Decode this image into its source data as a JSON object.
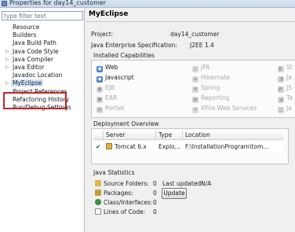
{
  "window": {
    "title": "Properties for day14_customer"
  },
  "sidebar": {
    "filter_placeholder": "type filter text",
    "items": [
      {
        "label": "Resource",
        "expandable": false
      },
      {
        "label": "Builders",
        "expandable": false
      },
      {
        "label": "Java Build Path",
        "expandable": false
      },
      {
        "label": "Java Code Style",
        "expandable": true
      },
      {
        "label": "Java Compiler",
        "expandable": true
      },
      {
        "label": "Java Editor",
        "expandable": true
      },
      {
        "label": "Javadoc Location",
        "expandable": false
      },
      {
        "label": "MyEclipse",
        "expandable": true,
        "selected": true
      },
      {
        "label": "Project References",
        "expandable": false
      },
      {
        "label": "Refactoring History",
        "expandable": false
      },
      {
        "label": "Run/Debug Settings",
        "expandable": false
      }
    ]
  },
  "main": {
    "title": "MyEclipse",
    "project_label": "Project:",
    "project_value": "day14_customer",
    "spec_label": "Java Enterprise Specification:",
    "spec_value": "J2EE 1.4",
    "capabilities_label": "Installed Capabilities",
    "capabilities": {
      "col1": [
        {
          "label": "Web",
          "enabled": true
        },
        {
          "label": "Javascript",
          "enabled": true
        },
        {
          "label": "EJB",
          "enabled": false
        },
        {
          "label": "EAR",
          "enabled": false
        },
        {
          "label": "Portlet",
          "enabled": false
        }
      ],
      "col2": [
        {
          "label": "JPA",
          "enabled": false
        },
        {
          "label": "Hibernate",
          "enabled": false
        },
        {
          "label": "Spring",
          "enabled": false
        },
        {
          "label": "Reporting",
          "enabled": false
        },
        {
          "label": "XFire Web Services",
          "enabled": false
        }
      ],
      "col3": [
        {
          "label": "St",
          "enabled": false
        },
        {
          "label": "Ja",
          "enabled": false
        },
        {
          "label": "JS",
          "enabled": false
        },
        {
          "label": "Ta",
          "enabled": false
        },
        {
          "label": "Ja",
          "enabled": false
        }
      ]
    },
    "deployment": {
      "label": "Deployment Overview",
      "columns": [
        "Server",
        "Type",
        "Location"
      ],
      "rows": [
        {
          "server": "Tomcat  6.x",
          "type": "Explo...",
          "location": "F:\\InstallationProgram\\tom..."
        }
      ]
    },
    "statistics": {
      "label": "Java Statistics",
      "source_folders_label": "Source Folders:",
      "source_folders_value": "0",
      "last_updated_label": "Last updated:",
      "last_updated_value": "N/A",
      "packages_label": "Packages:",
      "packages_value": "0",
      "classes_label": "Class/Interfaces:",
      "classes_value": "0",
      "lines_label": "Lines of Code:",
      "lines_value": "0",
      "update_button": "Update"
    }
  },
  "colors": {
    "highlight_box": "#c0272d",
    "enabled_icon": "#4f84c4",
    "disabled_text": "#a8a8a8"
  }
}
